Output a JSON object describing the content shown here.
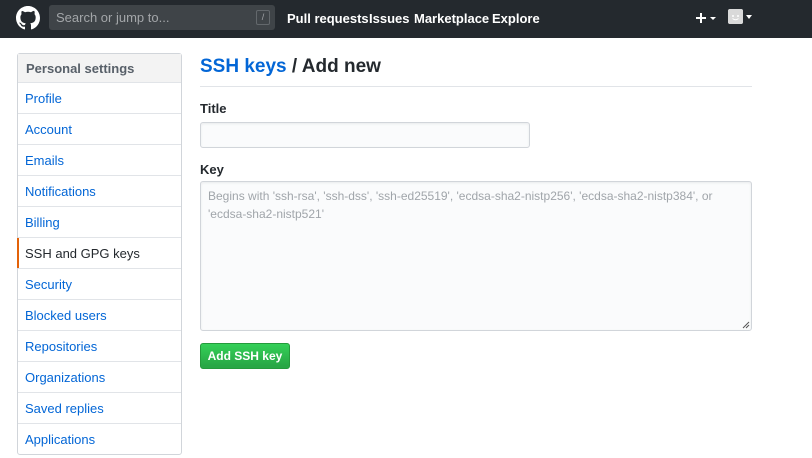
{
  "header": {
    "search_placeholder": "Search or jump to...",
    "search_shortcut": "/",
    "nav": [
      "Pull requests",
      "Issues",
      "Marketplace",
      "Explore"
    ],
    "icons": [
      "github-logo-icon",
      "plus-icon",
      "avatar-icon"
    ]
  },
  "sidebar": {
    "heading": "Personal settings",
    "items": [
      {
        "label": "Profile"
      },
      {
        "label": "Account"
      },
      {
        "label": "Emails"
      },
      {
        "label": "Notifications"
      },
      {
        "label": "Billing"
      },
      {
        "label": "SSH and GPG keys",
        "selected": true
      },
      {
        "label": "Security"
      },
      {
        "label": "Blocked users"
      },
      {
        "label": "Repositories"
      },
      {
        "label": "Organizations"
      },
      {
        "label": "Saved replies"
      },
      {
        "label": "Applications"
      }
    ]
  },
  "main": {
    "breadcrumb_link": "SSH keys",
    "breadcrumb_sep": " / ",
    "breadcrumb_current": "Add new",
    "title_label": "Title",
    "title_value": "",
    "key_label": "Key",
    "key_value": "",
    "key_placeholder": "Begins with 'ssh-rsa', 'ssh-dss', 'ssh-ed25519', 'ecdsa-sha2-nistp256', 'ecdsa-sha2-nistp384', or 'ecdsa-sha2-nistp521'",
    "submit_label": "Add SSH key"
  },
  "colors": {
    "header_bg": "#24292e",
    "link": "#0366d6",
    "button_green": "#28a745",
    "selected_marker": "#e36209"
  }
}
